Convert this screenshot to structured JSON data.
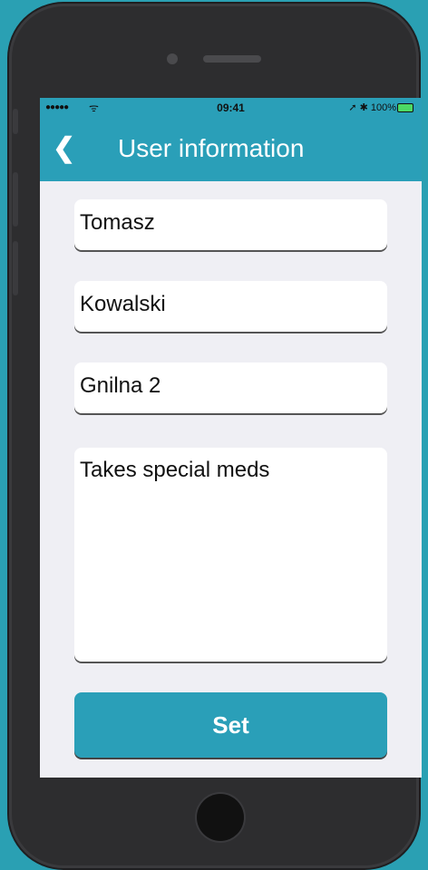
{
  "status_bar": {
    "signal": "●●●●●",
    "wifi": "ᯤ",
    "time": "09:41",
    "right": "➚ ✱ 100%",
    "battery_fill": 1.0
  },
  "nav": {
    "back_icon": "❮",
    "title": "User information"
  },
  "form": {
    "first_name": "Tomasz",
    "last_name": "Kowalski",
    "address": "Gnilna 2",
    "notes": "Takes special meds"
  },
  "actions": {
    "set_label": "Set"
  },
  "colors": {
    "accent": "#2a9fb8",
    "background": "#efeff4",
    "frame": "#2d2d2f",
    "outer": "#2aa0b3"
  }
}
